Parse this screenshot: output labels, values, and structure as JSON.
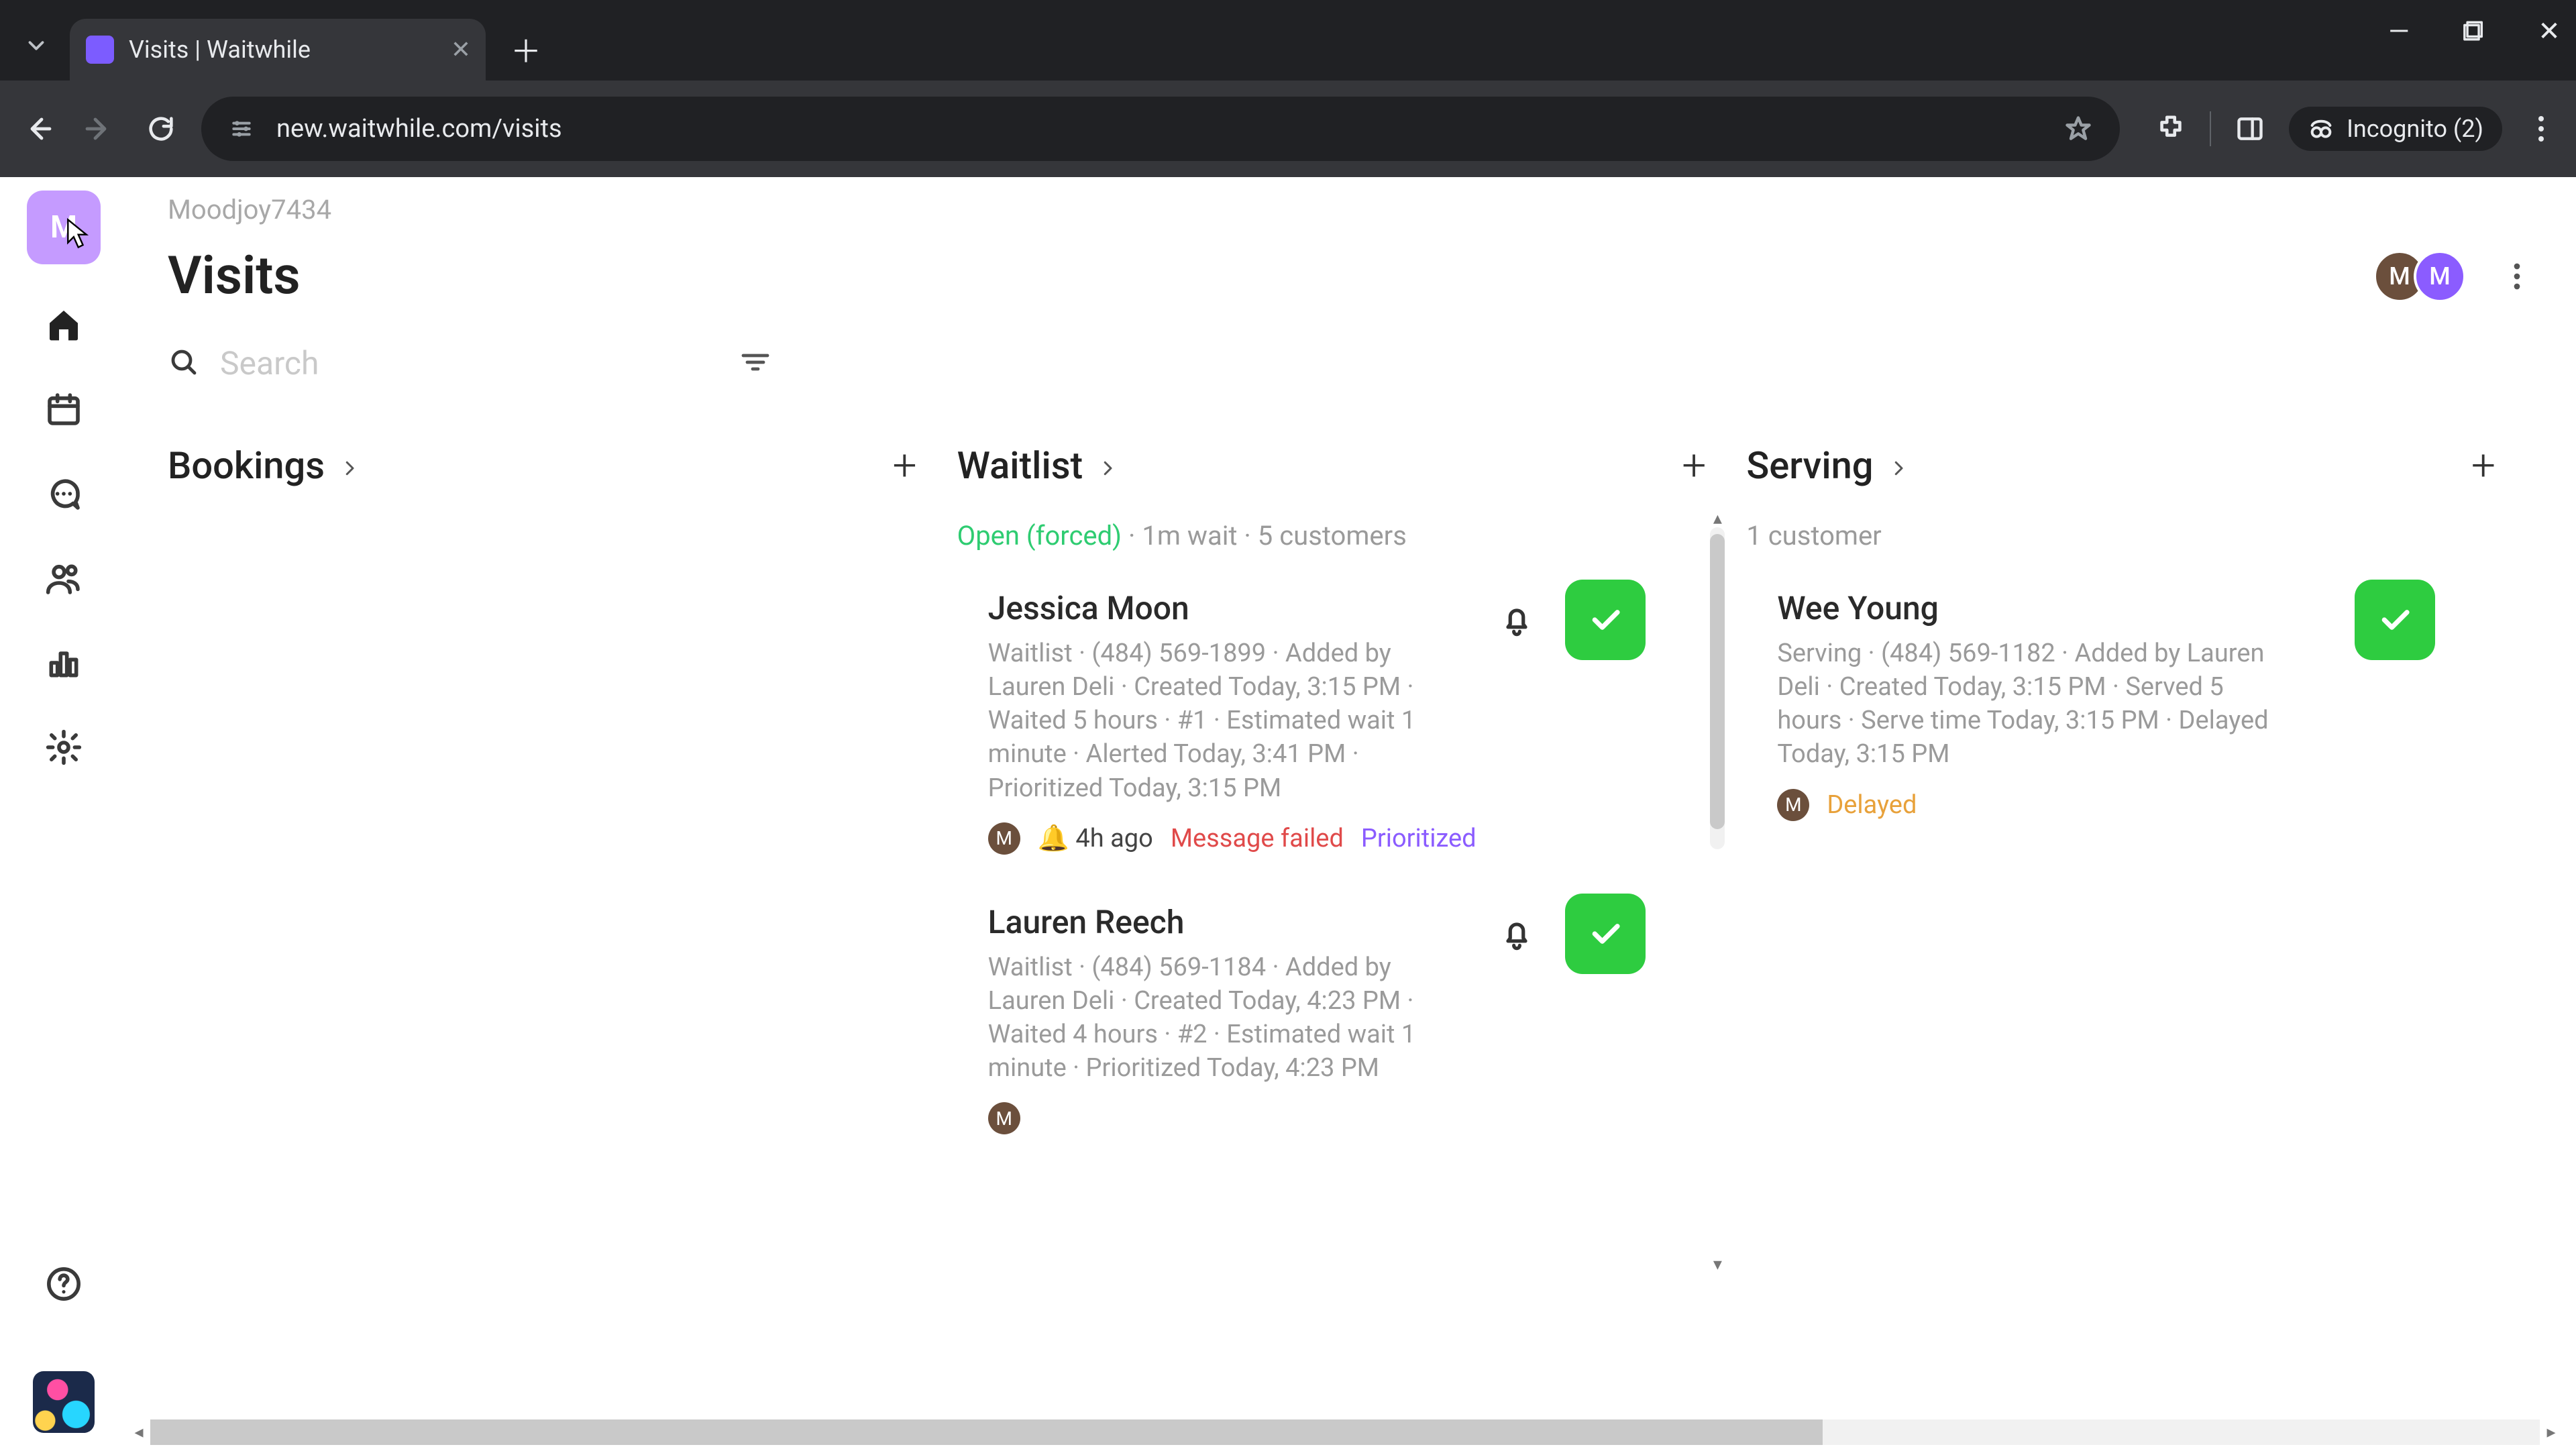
{
  "browser": {
    "tab_title": "Visits | Waitwhile",
    "url": "new.waitwhile.com/visits",
    "incognito_label": "Incognito (2)"
  },
  "rail": {
    "org_initial": "M"
  },
  "header": {
    "breadcrumb": "Moodjoy7434",
    "title": "Visits",
    "avatars": [
      "M",
      "M"
    ]
  },
  "search": {
    "placeholder": "Search"
  },
  "columns": {
    "bookings": {
      "title": "Bookings"
    },
    "waitlist": {
      "title": "Waitlist",
      "status_open": "Open (forced)",
      "status_rest": " · 1m wait · 5 customers",
      "cards": [
        {
          "name": "Jessica Moon",
          "meta": "Waitlist · (484) 569-1899 · Added by Lauren Deli · Created Today, 3:15 PM · Waited 5 hours · #1 · Estimated wait 1 minute · Alerted Today, 3:41 PM · Prioritized Today, 3:15 PM",
          "tag_initial": "M",
          "tag_time": "🔔 4h ago",
          "tag_fail": "Message failed",
          "tag_prio": "Prioritized"
        },
        {
          "name": "Lauren Reech",
          "meta": "Waitlist · (484) 569-1184 · Added by Lauren Deli · Created Today, 4:23 PM · Waited 4 hours · #2 · Estimated wait 1 minute · Prioritized Today, 4:23 PM",
          "tag_initial": "M"
        }
      ]
    },
    "serving": {
      "title": "Serving",
      "status": "1 customer",
      "cards": [
        {
          "name": "Wee Young",
          "meta": "Serving · (484) 569-1182 · Added by Lauren Deli · Created Today, 3:15 PM · Served 5 hours · Serve time Today, 3:15 PM · Delayed Today, 3:15 PM",
          "tag_initial": "M",
          "tag_delay": "Delayed"
        }
      ]
    }
  }
}
